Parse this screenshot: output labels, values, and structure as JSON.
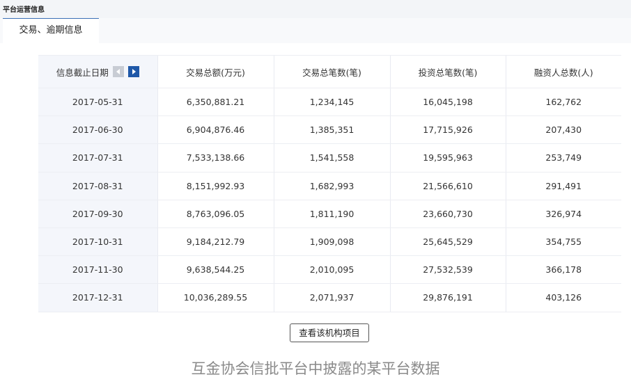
{
  "section": {
    "title": "平台运营信息"
  },
  "tabs": [
    {
      "label": "交易、逾期信息"
    }
  ],
  "table": {
    "headers": [
      "信息截止日期",
      "交易总额(万元)",
      "交易总笔数(笔)",
      "投资总笔数(笔)",
      "融资人总数(人)"
    ],
    "rows": [
      [
        "2017-05-31",
        "6,350,881.21",
        "1,234,145",
        "16,045,198",
        "162,762"
      ],
      [
        "2017-06-30",
        "6,904,876.46",
        "1,385,351",
        "17,715,926",
        "207,430"
      ],
      [
        "2017-07-31",
        "7,533,138.66",
        "1,541,558",
        "19,595,963",
        "253,749"
      ],
      [
        "2017-08-31",
        "8,151,992.93",
        "1,682,993",
        "21,566,610",
        "291,491"
      ],
      [
        "2017-09-30",
        "8,763,096.05",
        "1,811,190",
        "23,660,730",
        "326,974"
      ],
      [
        "2017-10-31",
        "9,184,212.79",
        "1,909,098",
        "25,645,529",
        "354,755"
      ],
      [
        "2017-11-30",
        "9,638,544.25",
        "2,010,095",
        "27,532,539",
        "366,178"
      ],
      [
        "2017-12-31",
        "10,036,289.55",
        "2,071,937",
        "29,876,191",
        "403,126"
      ]
    ]
  },
  "nav": {
    "prev_icon": "chevron-left-icon",
    "next_icon": "chevron-right-icon",
    "active_color": "#1f58a8"
  },
  "actions": {
    "view_projects_label": "查看该机构项目"
  },
  "caption": "互金协会信批平台中披露的某平台数据"
}
